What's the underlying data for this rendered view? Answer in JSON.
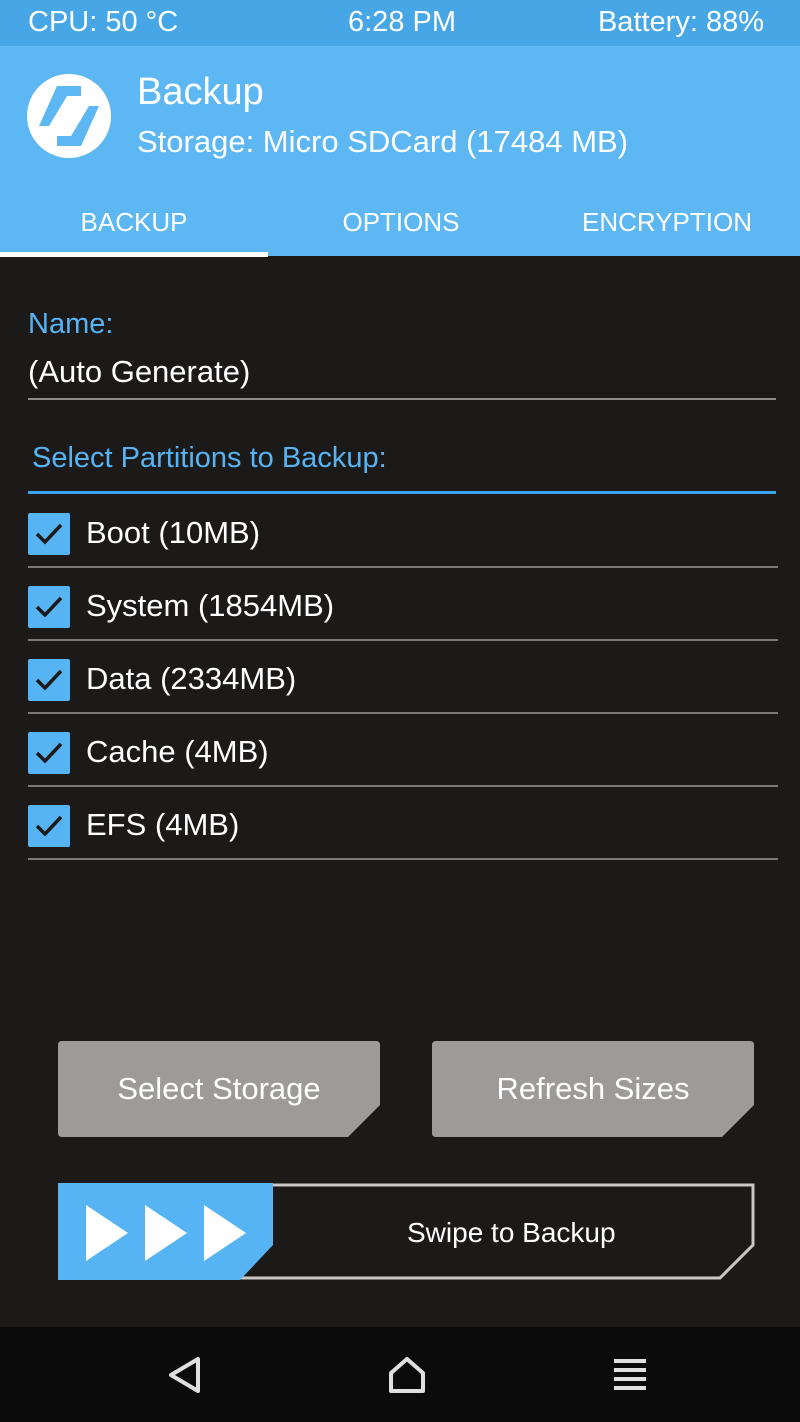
{
  "status": {
    "cpu": "CPU: 50 °C",
    "time": "6:28 PM",
    "battery": "Battery: 88%"
  },
  "header": {
    "title": "Backup",
    "storage": "Storage: Micro SDCard (17484 MB)",
    "logo_icon": "twrp-logo-icon"
  },
  "tabs": [
    {
      "label": "BACKUP",
      "active": true
    },
    {
      "label": "OPTIONS",
      "active": false
    },
    {
      "label": "ENCRYPTION",
      "active": false
    }
  ],
  "name": {
    "label": "Name:",
    "value": "(Auto Generate)"
  },
  "partitions": {
    "label": "Select Partitions to Backup:",
    "items": [
      {
        "label": "Boot (10MB)",
        "checked": true
      },
      {
        "label": "System (1854MB)",
        "checked": true
      },
      {
        "label": "Data (2334MB)",
        "checked": true
      },
      {
        "label": "Cache (4MB)",
        "checked": true
      },
      {
        "label": "EFS (4MB)",
        "checked": true
      }
    ]
  },
  "buttons": {
    "select_storage": "Select Storage",
    "refresh_sizes": "Refresh Sizes"
  },
  "swipe": {
    "label": "Swipe to Backup"
  },
  "nav": {
    "back_icon": "back-triangle-icon",
    "home_icon": "home-icon",
    "menu_icon": "menu-lines-icon"
  },
  "colors": {
    "accent": "#56b4f5",
    "header_bg": "#5db7f2",
    "statusbar_bg": "#47a6e6",
    "background": "#1c1a19",
    "button_gray": "#9c9b99"
  }
}
